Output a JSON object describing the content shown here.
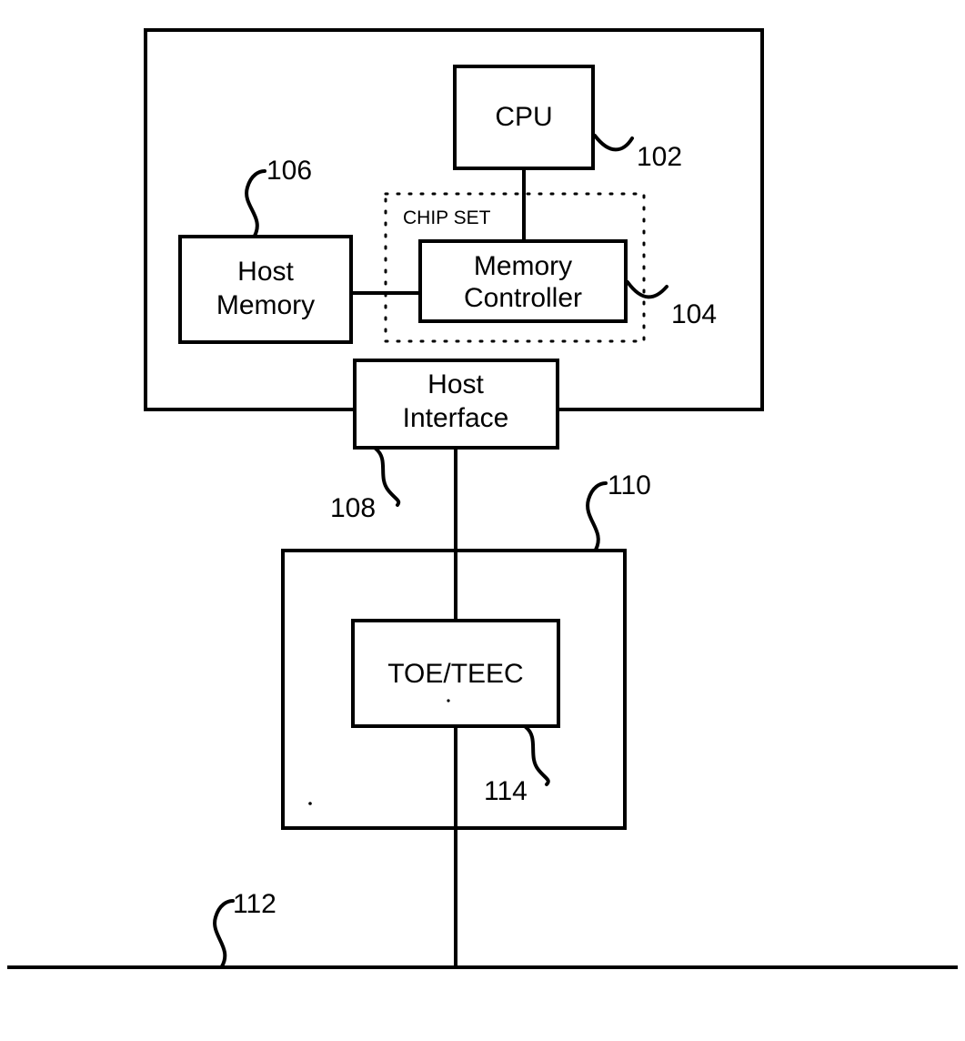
{
  "figure": {
    "type": "block-diagram",
    "blocks": [
      {
        "id": "cpu",
        "label": "CPU",
        "ref": "102"
      },
      {
        "id": "memctl",
        "label": "Memory\nController",
        "label_line1": "Memory",
        "label_line2": "Controller",
        "ref": "104"
      },
      {
        "id": "hostmem",
        "label": "Host\nMemory",
        "label_line1": "Host",
        "label_line2": "Memory",
        "ref": "106"
      },
      {
        "id": "hostif",
        "label": "Host\nInterface",
        "label_line1": "Host",
        "label_line2": "Interface",
        "ref": "108"
      },
      {
        "id": "toeteec",
        "label": "TOE/TEEC",
        "ref": "114"
      }
    ],
    "groups": [
      {
        "id": "chipset",
        "label": "CHIP SET",
        "style": "dotted"
      },
      {
        "id": "host",
        "label": "",
        "style": "solid",
        "ref": ""
      },
      {
        "id": "nic",
        "label": "",
        "style": "solid",
        "ref": "110"
      }
    ],
    "bus": {
      "id": "network",
      "label": "",
      "ref": "112"
    },
    "reference_numerals": [
      "102",
      "104",
      "106",
      "108",
      "110",
      "112",
      "114"
    ],
    "colors": {
      "stroke": "#000000",
      "background": "#ffffff",
      "text": "#000000"
    }
  },
  "labels": {
    "cpu": "CPU",
    "memory_controller_line1": "Memory",
    "memory_controller_line2": "Controller",
    "host_memory_line1": "Host",
    "host_memory_line2": "Memory",
    "host_interface_line1": "Host",
    "host_interface_line2": "Interface",
    "toe_teec": "TOE/TEEC",
    "chip_set": "CHIP SET"
  },
  "refs": {
    "cpu": "102",
    "memory_controller": "104",
    "host_memory": "106",
    "host_interface": "108",
    "nic": "110",
    "network_bus": "112",
    "toe_teec": "114"
  }
}
